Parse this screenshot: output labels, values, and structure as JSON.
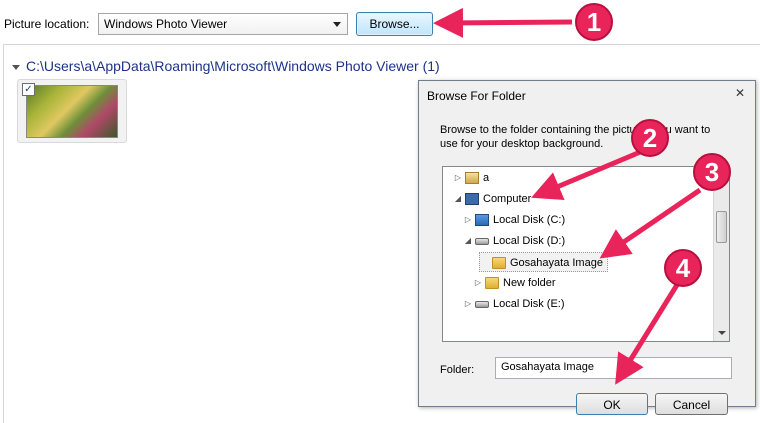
{
  "toolbar": {
    "picture_location_label": "Picture location:",
    "picture_location_value": "Windows Photo Viewer",
    "browse_label": "Browse..."
  },
  "gallery": {
    "group_header": "C:\\Users\\a\\AppData\\Roaming\\Microsoft\\Windows Photo Viewer (1)",
    "thumbnail_checked": "✓"
  },
  "dialog": {
    "title": "Browse For Folder",
    "close_glyph": "✕",
    "description": "Browse to the folder containing the pictures you want to use for your desktop background.",
    "tree": [
      {
        "label": "a",
        "expander": "▷",
        "icon": "user-folder-icon"
      },
      {
        "label": "Computer",
        "expander": "◢",
        "icon": "computer-icon"
      },
      {
        "label": "Local Disk (C:)",
        "expander": "▷",
        "icon": "drive-c-icon"
      },
      {
        "label": "Local Disk (D:)",
        "expander": "◢",
        "icon": "drive-icon"
      },
      {
        "label": "Gosahayata Image",
        "expander": "",
        "icon": "folder-icon",
        "selected": true
      },
      {
        "label": "New folder",
        "expander": "▷",
        "icon": "folder-icon"
      },
      {
        "label": "Local Disk (E:)",
        "expander": "▷",
        "icon": "drive-icon"
      }
    ],
    "folder_label": "Folder:",
    "folder_value": "Gosahayata Image",
    "ok_label": "OK",
    "cancel_label": "Cancel"
  },
  "annotations": {
    "step1": "1",
    "step2": "2",
    "step3": "3",
    "step4": "4",
    "arrow_color": "#e8245a",
    "badge_fill": "#e8245a",
    "badge_stroke": "#b8103e"
  }
}
